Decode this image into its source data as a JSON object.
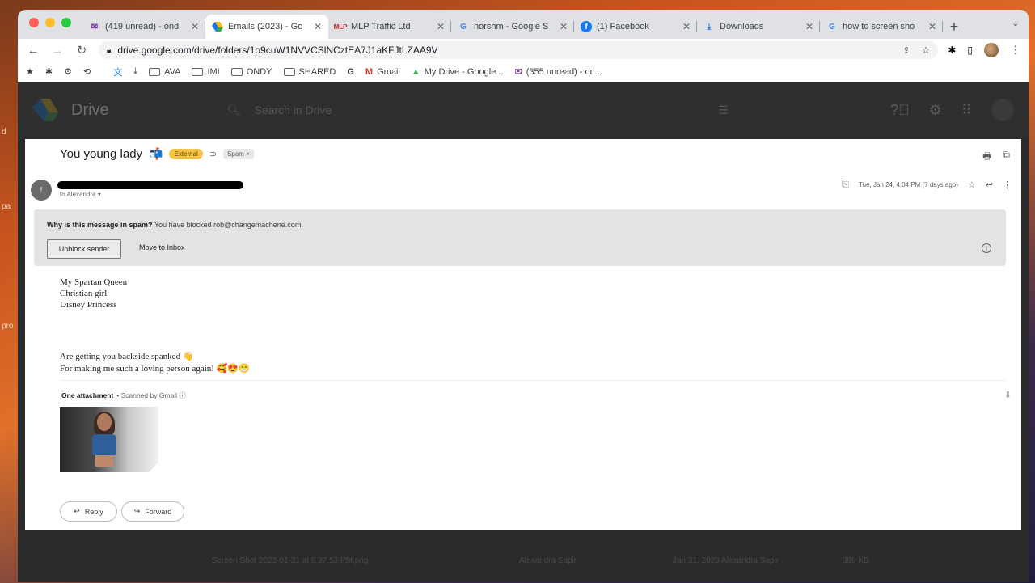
{
  "desktop": {
    "labels": [
      "d",
      "pa",
      "pro"
    ]
  },
  "browser": {
    "tabs": [
      {
        "title": "(419 unread) - ond",
        "icon": "mail-icon",
        "active": false
      },
      {
        "title": "Emails (2023) - Go",
        "icon": "drive-icon",
        "active": true
      },
      {
        "title": "MLP Traffic Ltd",
        "icon": "mlp-icon",
        "active": false
      },
      {
        "title": "horshm - Google S",
        "icon": "google-icon",
        "active": false
      },
      {
        "title": "(1) Facebook",
        "icon": "facebook-icon",
        "active": false
      },
      {
        "title": "Downloads",
        "icon": "download-icon",
        "active": false
      },
      {
        "title": "how to screen sho",
        "icon": "google-icon",
        "active": false
      }
    ],
    "url": "drive.google.com/drive/folders/1o9cuW1NVVCSlNCztEA7J1aKFJtLZAA9V",
    "bookmarks": [
      {
        "label": "AVA",
        "type": "folder"
      },
      {
        "label": "IMI",
        "type": "folder"
      },
      {
        "label": "ONDY",
        "type": "folder"
      },
      {
        "label": "SHARED",
        "type": "folder"
      },
      {
        "label": "Gmail",
        "type": "gmail"
      },
      {
        "label": "My Drive - Google...",
        "type": "drive"
      },
      {
        "label": "(355 unread) - on...",
        "type": "mail"
      }
    ]
  },
  "drive": {
    "name": "Drive",
    "search_placeholder": "Search in Drive",
    "file_row": {
      "name": "Screen Shot 2023-01-31 at 6.37.53 PM.png",
      "owner": "Alexandra Sapir",
      "modified": "Jan 31, 2023 Alexandra Sapir",
      "size": "389 KB"
    }
  },
  "email": {
    "subject": "You young lady",
    "chip_external": "External",
    "chip_spam": "Spam ×",
    "to": "to Alexandra ▾",
    "date": "Tue, Jan 24, 4:04 PM (7 days ago)",
    "spam_notice": {
      "question": "Why is this message in spam?",
      "reason": "You have blocked rob@changemachene.com.",
      "unblock_label": "Unblock sender",
      "move_label": "Move to Inbox"
    },
    "body_lines_1": [
      "My Spartan Queen",
      "Christian girl",
      "Disney Princess"
    ],
    "body_lines_2": [
      "Are getting you backside spanked 👋",
      "For making me such a loving person again! 🥰😍😁"
    ],
    "attachment": {
      "heading": "One attachment",
      "scanned": "• Scanned by Gmail ⓘ"
    },
    "reply_label": "Reply",
    "forward_label": "Forward"
  }
}
